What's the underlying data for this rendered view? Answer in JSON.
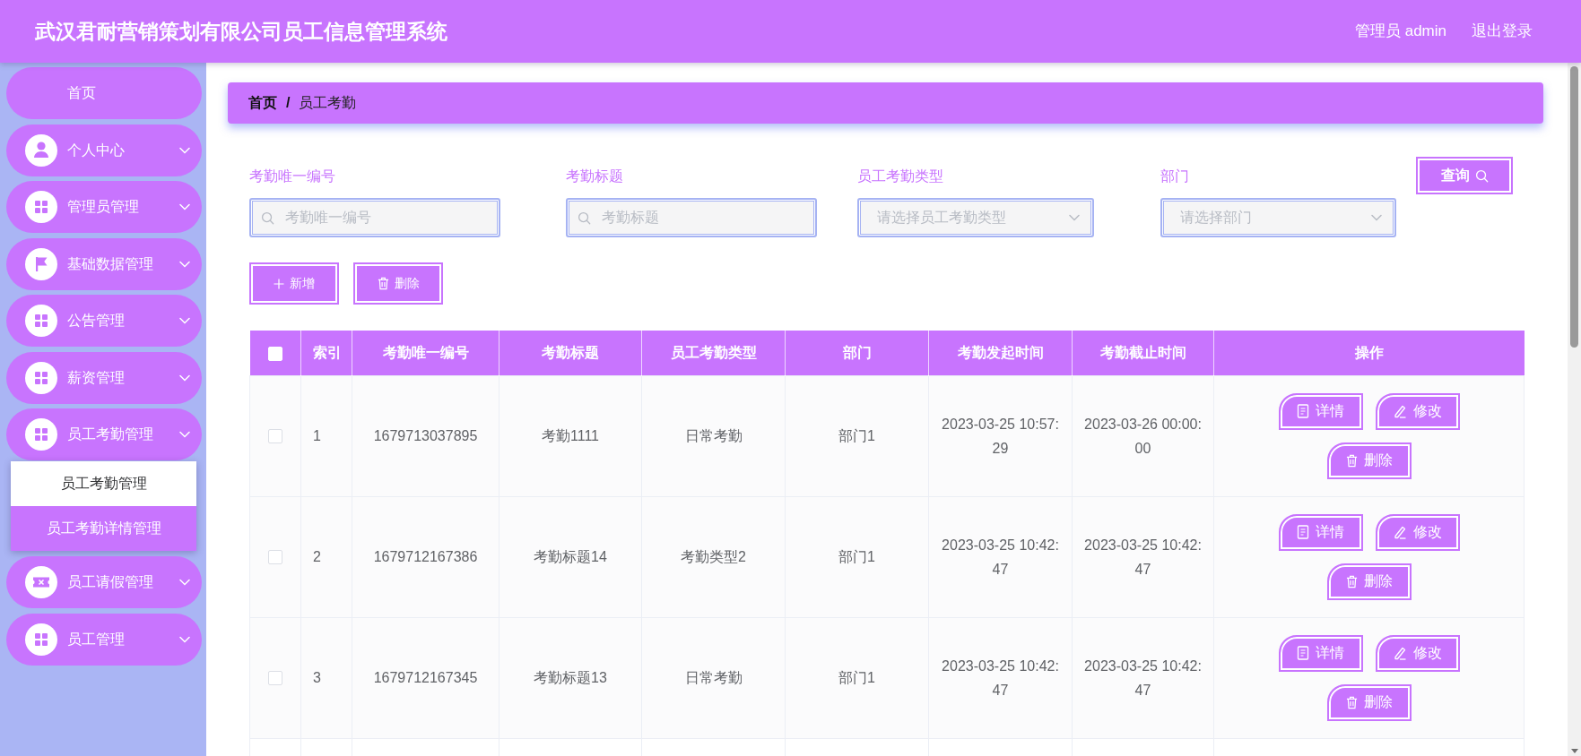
{
  "header": {
    "title": "武汉君耐营销策划有限公司员工信息管理系统",
    "user": "管理员 admin",
    "logout": "退出登录"
  },
  "sidebar": {
    "items": [
      {
        "kind": "link",
        "label": "首页"
      },
      {
        "kind": "menu",
        "label": "个人中心"
      },
      {
        "kind": "menu",
        "label": "管理员管理"
      },
      {
        "kind": "menu",
        "label": "基础数据管理"
      },
      {
        "kind": "menu",
        "label": "公告管理"
      },
      {
        "kind": "menu",
        "label": "薪资管理"
      },
      {
        "kind": "menu",
        "label": "员工考勤管理",
        "children": [
          {
            "label": "员工考勤管理",
            "selected": true
          },
          {
            "label": "员工考勤详情管理",
            "selected": false
          }
        ]
      },
      {
        "kind": "menu",
        "label": "员工请假管理"
      },
      {
        "kind": "menu",
        "label": "员工管理"
      }
    ]
  },
  "breadcrumb": {
    "items": [
      "首页",
      "员工考勤"
    ],
    "separator": "/"
  },
  "filters": [
    {
      "kind": "text",
      "label": "考勤唯一编号",
      "placeholder": "考勤唯一编号"
    },
    {
      "kind": "text",
      "label": "考勤标题",
      "placeholder": "考勤标题"
    },
    {
      "kind": "select",
      "label": "员工考勤类型",
      "placeholder": "请选择员工考勤类型"
    },
    {
      "kind": "select",
      "label": "部门",
      "placeholder": "请选择部门"
    }
  ],
  "search_button": {
    "label": "查询"
  },
  "actions": [
    {
      "kind": "add",
      "label": "新增"
    },
    {
      "kind": "delete",
      "label": "删除"
    }
  ],
  "table": {
    "select_all": {
      "checked": false
    },
    "columns": [
      "索引",
      "考勤唯一编号",
      "考勤标题",
      "员工考勤类型",
      "部门",
      "考勤发起时间",
      "考勤截止时间",
      "操作"
    ],
    "rows": [
      {
        "checked": false,
        "cells": [
          "1",
          "1679713037895",
          "考勤1111",
          "日常考勤",
          "部门1",
          "2023-03-25 10:57:29",
          "2023-03-26 00:00:00"
        ],
        "actions": [
          {
            "kind": "detail",
            "label": "详情"
          },
          {
            "kind": "edit",
            "label": "修改"
          },
          {
            "kind": "delete",
            "label": "删除"
          }
        ]
      },
      {
        "checked": false,
        "cells": [
          "2",
          "1679712167386",
          "考勤标题14",
          "考勤类型2",
          "部门1",
          "2023-03-25 10:42:47",
          "2023-03-25 10:42:47"
        ],
        "actions": [
          {
            "kind": "detail",
            "label": "详情"
          },
          {
            "kind": "edit",
            "label": "修改"
          },
          {
            "kind": "delete",
            "label": "删除"
          }
        ]
      },
      {
        "checked": false,
        "cells": [
          "3",
          "1679712167345",
          "考勤标题13",
          "日常考勤",
          "部门1",
          "2023-03-25 10:42:47",
          "2023-03-25 10:42:47"
        ],
        "actions": [
          {
            "kind": "detail",
            "label": "详情"
          },
          {
            "kind": "edit",
            "label": "修改"
          },
          {
            "kind": "delete",
            "label": "删除"
          }
        ]
      }
    ]
  }
}
